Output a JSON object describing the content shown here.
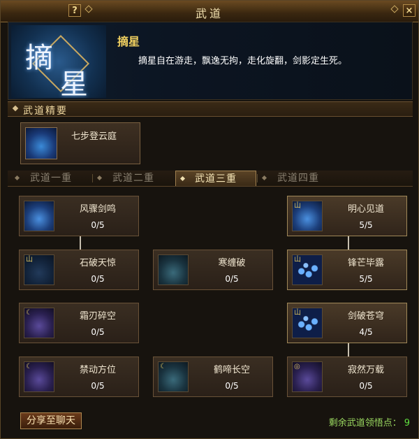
{
  "window": {
    "title": "武道",
    "help_label": "?",
    "close_label": "×"
  },
  "header": {
    "skill_name": "摘星",
    "description": "摘星自在游走，飘逸无拘，走化旋翻，剑影定生死。",
    "emblem_chars": [
      "摘",
      "星"
    ]
  },
  "section": {
    "label": "武道精要"
  },
  "essential": {
    "name": "七步登云庭"
  },
  "tabs": [
    {
      "label": "武道一重",
      "active": false
    },
    {
      "label": "武道二重",
      "active": false
    },
    {
      "label": "武道三重",
      "active": true
    },
    {
      "label": "武道四重",
      "active": false
    }
  ],
  "skills": {
    "r1c1": {
      "name": "风骤剑鸣",
      "level": "0/5"
    },
    "r1c3": {
      "name": "明心见道",
      "level": "5/5"
    },
    "r2c1": {
      "name": "石破天惊",
      "level": "0/5"
    },
    "r2c2": {
      "name": "寒缠破",
      "level": "0/5"
    },
    "r2c3": {
      "name": "锋芒毕露",
      "level": "5/5"
    },
    "r3c1": {
      "name": "霜刃碎空",
      "level": "0/5"
    },
    "r3c3": {
      "name": "剑破苍穹",
      "level": "4/5"
    },
    "r4c1": {
      "name": "禁动方位",
      "level": "0/5"
    },
    "r4c2": {
      "name": "鹤啼长空",
      "level": "0/5"
    },
    "r4c3": {
      "name": "寂然万载",
      "level": "0/5"
    }
  },
  "footer": {
    "share_label": "分享至聊天",
    "points_label": "剩余武道领悟点：",
    "points_value": "9"
  },
  "colors": {
    "accent_gold": "#f0d060",
    "points_green": "#60e040"
  }
}
